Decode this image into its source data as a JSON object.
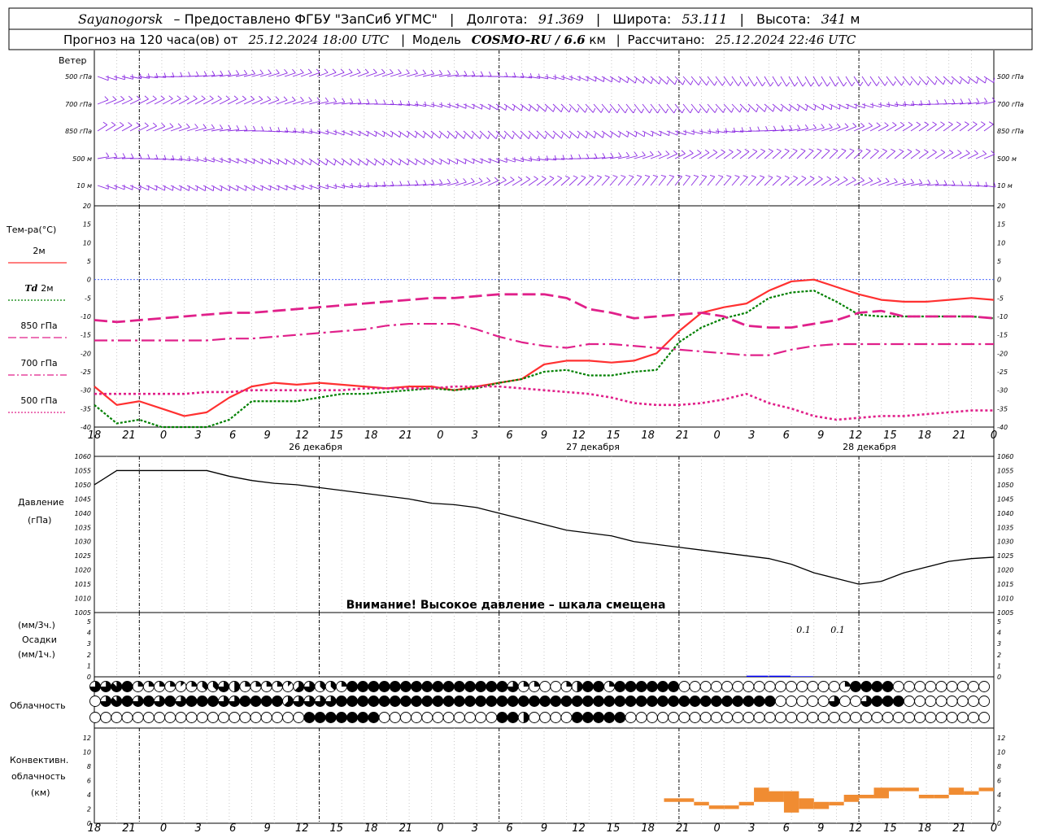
{
  "header": {
    "city": "Sayanogorsk",
    "provider": "– Предоставлено ФГБУ \"ЗапСиб УГМС\"",
    "lon_label": "Долгота:",
    "lon_value": "91.369",
    "lat_label": "Широта:",
    "lat_value": "53.111",
    "alt_label": "Высота:",
    "alt_value": "341",
    "alt_unit": "м",
    "forecast_label": "Прогноз на 120 часа(ов) от",
    "forecast_start": "25.12.2024 18:00 UTC",
    "model_label": "Модель",
    "model_name": "COSMO-RU / 6.6",
    "model_unit": "км",
    "calc_label": "Рассчитано:",
    "calc_time": "25.12.2024 22:46 UTC"
  },
  "wind_panel": {
    "title": "Ветер",
    "levels": [
      "500 гПа",
      "700 гПа",
      "850 гПа",
      "500 м",
      "10 м"
    ],
    "color": "#8b2be2"
  },
  "temp_panel": {
    "title": "Тем-ра(°С)",
    "legend": [
      {
        "label": "2м",
        "prefix": "",
        "color": "#ff3030",
        "style": "solid"
      },
      {
        "label": "2м",
        "prefix": "Td",
        "color": "#008000",
        "style": "dotted"
      },
      {
        "label": "850 гПа",
        "prefix": "",
        "color": "#e0208a",
        "style": "dash"
      },
      {
        "label": "700 гПа",
        "prefix": "",
        "color": "#e0208a",
        "style": "dashdot"
      },
      {
        "label": "500 гПа",
        "prefix": "",
        "color": "#e0208a",
        "style": "dot"
      }
    ],
    "yticks": [
      "20",
      "15",
      "10",
      "5",
      "0",
      "-5",
      "-10",
      "-15",
      "-20",
      "-25",
      "-30",
      "-35",
      "-40"
    ]
  },
  "x_axis": {
    "hours": [
      "18",
      "21",
      "0",
      "3",
      "6",
      "9",
      "12",
      "15",
      "18",
      "21",
      "0",
      "3",
      "6",
      "9",
      "12",
      "15",
      "18",
      "21",
      "0",
      "3",
      "6",
      "9",
      "12",
      "15",
      "18",
      "21",
      "0"
    ],
    "dates": [
      "26 декабря",
      "27 декабря",
      "28 декабря"
    ]
  },
  "pressure_panel": {
    "title": "Давление",
    "unit": "(гПа)",
    "warning": "Внимание! Высокое давление – шкала смещена",
    "yticks": [
      "1060",
      "1055",
      "1050",
      "1045",
      "1040",
      "1035",
      "1030",
      "1025",
      "1020",
      "1015",
      "1010",
      "1005"
    ]
  },
  "precip_panel": {
    "unit_3h": "(мм/3ч.)",
    "title": "Осадки",
    "unit_1h": "(мм/1ч.)",
    "yticks": [
      "5",
      "4",
      "3",
      "2",
      "1",
      "0"
    ],
    "annotations": [
      "0.1",
      "0.1"
    ]
  },
  "cloud_panel": {
    "title": "Облачность"
  },
  "conv_panel": {
    "title_1": "Конвективн.",
    "title_2": "облачность",
    "unit": "(км)",
    "yticks": [
      "12",
      "10",
      "8",
      "6",
      "4",
      "2",
      "0"
    ]
  },
  "chart_data": [
    {
      "type": "line",
      "title": "Тем-ра(°С)",
      "x_hours_from_start": [
        0,
        3,
        6,
        9,
        12,
        15,
        18,
        21,
        24,
        27,
        30,
        33,
        36,
        39,
        42,
        45,
        48,
        51,
        54,
        57,
        60,
        63,
        66,
        69,
        72,
        75,
        78,
        81,
        84,
        87,
        90,
        93,
        96,
        99,
        102,
        105,
        108,
        111,
        114,
        117,
        120
      ],
      "ylim": [
        -40,
        20
      ],
      "series": [
        {
          "name": "2м",
          "color": "#ff3030",
          "values": [
            -29,
            -34,
            -33,
            -35,
            -37,
            -36,
            -32,
            -29,
            -28,
            -28.5,
            -28,
            -28.5,
            -29,
            -29.5,
            -29,
            -29,
            -30,
            -29,
            -28,
            -27,
            -23,
            -22,
            -22,
            -22.5,
            -22,
            -20,
            -14,
            -9,
            -7.5,
            -6.5,
            -3,
            -0.5,
            0,
            -2,
            -4,
            -5.5,
            -6,
            -6,
            -5.5,
            -5,
            -5.5
          ]
        },
        {
          "name": "Td 2м",
          "color": "#008000",
          "values": [
            -34,
            -39,
            -38,
            -40,
            -42,
            -43,
            -38,
            -33,
            -33,
            -33,
            -32,
            -31,
            -31,
            -30.5,
            -30,
            -29.5,
            -30,
            -29.5,
            -28,
            -27,
            -25,
            -24.5,
            -26,
            -26,
            -25,
            -24.5,
            -17,
            -13,
            -10.5,
            -9,
            -5,
            -3.5,
            -3,
            -6,
            -9.5,
            -10,
            -10,
            -10,
            -10,
            -10,
            -10.5
          ]
        },
        {
          "name": "850 гПа",
          "color": "#e0208a",
          "values": [
            -11,
            -11.5,
            -11,
            -10.5,
            -10,
            -9.5,
            -9,
            -9,
            -8.5,
            -8,
            -7.5,
            -7,
            -6.5,
            -6,
            -5.5,
            -5,
            -5,
            -4.5,
            -4,
            -4,
            -4,
            -5,
            -8,
            -9,
            -10.5,
            -10,
            -9.5,
            -9,
            -10,
            -12.5,
            -13,
            -13,
            -12,
            -11,
            -9,
            -8.5,
            -10,
            -10,
            -10,
            -10,
            -10.5
          ]
        },
        {
          "name": "700 гПа",
          "color": "#e0208a",
          "values": [
            -16.5,
            -16.5,
            -16.5,
            -16.5,
            -16.5,
            -16.5,
            -16,
            -16,
            -15.5,
            -15,
            -14.5,
            -14,
            -13.5,
            -12.5,
            -12,
            -12,
            -12,
            -13.5,
            -15.5,
            -17,
            -18,
            -18.5,
            -17.5,
            -17.5,
            -18,
            -18.5,
            -19,
            -19.5,
            -20,
            -20.5,
            -20.5,
            -19,
            -18,
            -17.5,
            -17.5,
            -17.5,
            -17.5,
            -17.5,
            -17.5,
            -17.5,
            -17.5
          ]
        },
        {
          "name": "500 гПа",
          "color": "#e0208a",
          "values": [
            -31,
            -31,
            -31,
            -31,
            -31,
            -30.5,
            -30.5,
            -30,
            -30,
            -30,
            -30,
            -30,
            -29.5,
            -29.5,
            -29.5,
            -29.5,
            -29,
            -29,
            -29,
            -29.5,
            -30,
            -30.5,
            -31,
            -32,
            -33.5,
            -34,
            -34,
            -33.5,
            -32.5,
            -31,
            -33.5,
            -35,
            -37,
            -38,
            -37.5,
            -37,
            -37,
            -36.5,
            -36,
            -35.5,
            -35.5
          ]
        }
      ]
    },
    {
      "type": "line",
      "title": "Давление",
      "x_hours_from_start": [
        0,
        3,
        6,
        9,
        12,
        15,
        18,
        21,
        24,
        27,
        30,
        33,
        36,
        39,
        42,
        45,
        48,
        51,
        54,
        57,
        60,
        63,
        66,
        69,
        72,
        75,
        78,
        81,
        84,
        87,
        90,
        93,
        96,
        99,
        102,
        105,
        108,
        111,
        114,
        117,
        120
      ],
      "ylim": [
        1005,
        1060
      ],
      "series": [
        {
          "name": "Давление",
          "color": "#000000",
          "values": [
            1050,
            1055,
            1055,
            1055,
            1055,
            1055,
            1053,
            1051.5,
            1050.5,
            1050,
            1049,
            1048,
            1047,
            1046,
            1045,
            1043.5,
            1043,
            1042,
            1040,
            1038,
            1036,
            1034,
            1033,
            1032,
            1030,
            1029,
            1028,
            1027,
            1026,
            1025,
            1024,
            1022,
            1019,
            1017,
            1015,
            1016,
            1019,
            1021,
            1023,
            1024,
            1024.5
          ]
        }
      ]
    },
    {
      "type": "bar",
      "title": "Осадки",
      "x_hours_from_start": [
        87,
        90,
        93
      ],
      "ylim": [
        0,
        5
      ],
      "series": [
        {
          "name": "Осадки",
          "color": "#0000ff",
          "values": [
            0.1,
            0.1,
            0.05
          ]
        }
      ]
    },
    {
      "type": "bar",
      "title": "Конвективн. облачность",
      "x_hours_from_start": [
        76,
        78,
        80,
        82,
        84,
        86,
        88,
        90,
        92,
        94,
        96,
        98,
        100,
        102,
        104,
        106,
        108,
        110,
        112,
        114,
        116,
        118
      ],
      "ylim": [
        0,
        12
      ],
      "series": [
        {
          "name": "bottom_km",
          "color": "#f08c32",
          "values": [
            3,
            3,
            2.5,
            2,
            2,
            2.5,
            3,
            3,
            1.5,
            2,
            2,
            2.5,
            3,
            3.5,
            3.5,
            4.5,
            4.5,
            3.5,
            3.5,
            4,
            4,
            4.5
          ]
        },
        {
          "name": "top_km",
          "color": "#f08c32",
          "values": [
            3.5,
            3.5,
            3,
            2.5,
            2.5,
            3,
            5,
            4.5,
            4.5,
            3.5,
            3,
            3,
            4,
            4,
            5,
            5,
            5,
            4,
            4,
            5,
            4.5,
            5
          ]
        }
      ]
    },
    {
      "type": "table",
      "title": "Облачность",
      "levels": [
        "high",
        "mid",
        "low"
      ],
      "eighths_per_step_note": "values 0..8 okta per 3h column, 42 columns",
      "rows": [
        [
          6,
          6,
          7,
          8,
          2,
          2,
          2,
          2,
          1,
          2,
          3,
          3,
          6,
          4,
          2,
          2,
          2,
          2,
          1,
          5,
          6,
          3,
          3,
          2,
          8,
          8,
          8,
          8,
          8,
          8,
          8,
          8,
          8,
          8,
          8,
          8,
          8,
          8,
          8,
          6,
          2,
          2,
          0,
          0,
          2,
          4,
          8,
          8,
          2,
          8,
          8,
          8,
          8,
          8,
          8,
          0,
          0,
          0,
          0,
          0,
          0,
          0,
          0,
          0,
          0,
          0,
          0,
          0,
          0,
          0,
          2,
          8,
          8,
          8,
          8
        ],
        [
          0,
          6,
          7,
          8,
          6,
          8,
          6,
          8,
          6,
          8,
          8,
          8,
          6,
          6,
          8,
          8,
          8,
          8,
          5,
          6,
          6,
          6,
          6,
          8,
          8,
          8,
          8,
          8,
          8,
          8,
          8,
          8,
          8,
          8,
          8,
          8,
          8,
          8,
          8,
          8,
          8,
          8,
          8,
          8,
          8,
          8,
          8,
          8,
          8,
          8,
          8,
          8,
          8,
          8,
          8,
          8,
          8,
          8,
          8,
          8,
          8,
          8,
          8,
          8,
          0,
          0,
          0,
          0,
          0,
          6,
          0,
          0,
          6,
          8,
          8,
          8
        ],
        [
          0,
          0,
          0,
          0,
          0,
          0,
          0,
          0,
          0,
          0,
          0,
          0,
          0,
          0,
          0,
          0,
          0,
          0,
          0,
          0,
          8,
          8,
          8,
          8,
          8,
          8,
          8,
          0,
          0,
          0,
          0,
          0,
          0,
          0,
          0,
          0,
          0,
          0,
          8,
          8,
          4,
          0,
          0,
          0,
          0,
          8,
          8,
          8,
          8,
          8,
          0,
          0,
          0,
          0,
          0,
          0,
          0,
          0,
          0,
          0,
          0,
          0,
          0,
          0,
          0,
          0,
          0,
          0,
          0,
          0,
          0,
          0,
          0
        ]
      ]
    }
  ]
}
